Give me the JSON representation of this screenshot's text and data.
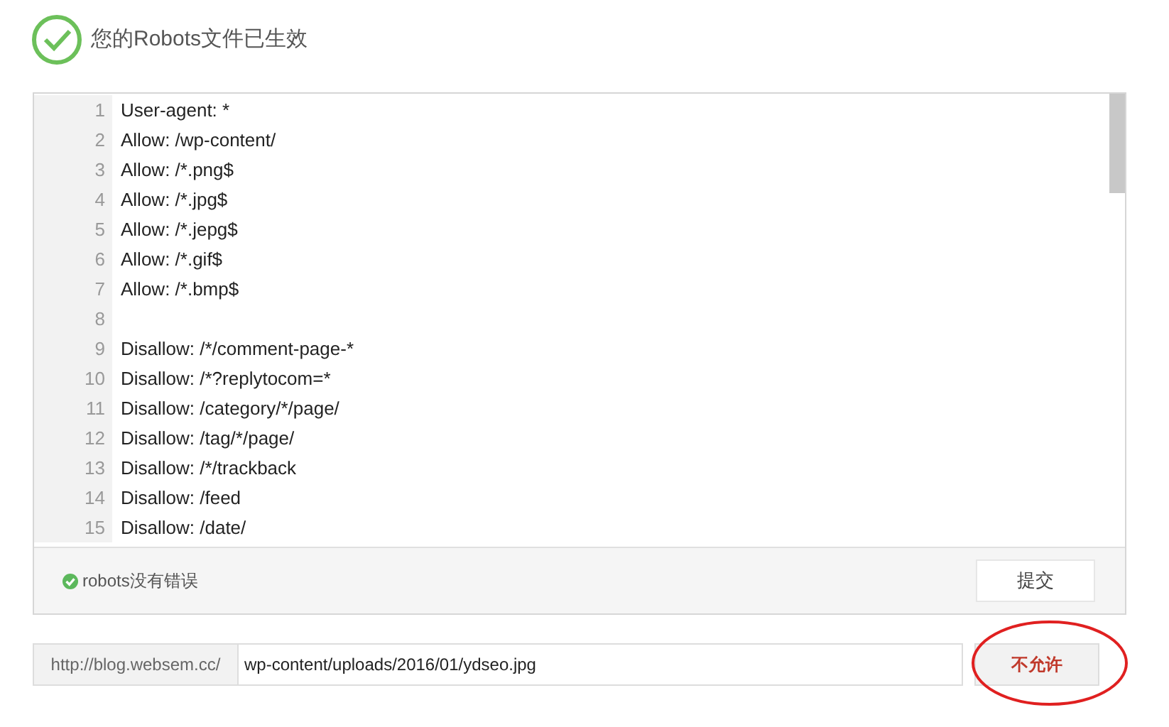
{
  "header": {
    "title": "您的Robots文件已生效"
  },
  "editor": {
    "lines": [
      {
        "number": "1",
        "text": "User-agent: *"
      },
      {
        "number": "2",
        "text": "Allow: /wp-content/"
      },
      {
        "number": "3",
        "text": "Allow: /*.png$"
      },
      {
        "number": "4",
        "text": "Allow: /*.jpg$"
      },
      {
        "number": "5",
        "text": "Allow: /*.jepg$"
      },
      {
        "number": "6",
        "text": "Allow: /*.gif$"
      },
      {
        "number": "7",
        "text": "Allow: /*.bmp$"
      },
      {
        "number": "8"
      },
      {
        "number": "9",
        "text": "Disallow: /*/comment-page-*"
      },
      {
        "number": "10",
        "text": "Disallow: /*?replytocom=*"
      },
      {
        "number": "11",
        "text": "Disallow: /category/*/page/"
      },
      {
        "number": "12",
        "text": "Disallow: /tag/*/page/"
      },
      {
        "number": "13",
        "text": "Disallow: /*/trackback"
      },
      {
        "number": "14",
        "text": "Disallow: /feed"
      },
      {
        "number": "15",
        "text": "Disallow: /date/"
      }
    ],
    "status": "robots没有错误",
    "submit_button": "提交"
  },
  "url_check": {
    "prefix": "http://blog.websem.cc/",
    "value": "wp-content/uploads/2016/01/ydseo.jpg",
    "result_button": "不允许"
  }
}
